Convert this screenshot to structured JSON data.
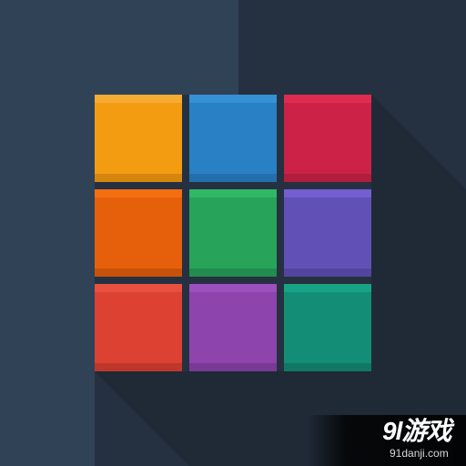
{
  "colors": {
    "background": "#253140",
    "background_light": "#304256",
    "long_shadow": "#1f2a36"
  },
  "tiles": [
    {
      "name": "tile-orange",
      "color": "#f39c12",
      "top": "#f6ab33",
      "bottom": "#d4860f"
    },
    {
      "name": "tile-blue",
      "color": "#2980c4",
      "top": "#3591d4",
      "bottom": "#236fac"
    },
    {
      "name": "tile-crimson",
      "color": "#cc2247",
      "top": "#de2c50",
      "bottom": "#b01d3d"
    },
    {
      "name": "tile-dark-orange",
      "color": "#e6600b",
      "top": "#f56f12",
      "bottom": "#c75209"
    },
    {
      "name": "tile-green",
      "color": "#27a45a",
      "top": "#2fb866",
      "bottom": "#218c4d"
    },
    {
      "name": "tile-indigo",
      "color": "#6151b7",
      "top": "#735fd1",
      "bottom": "#53459e"
    },
    {
      "name": "tile-red",
      "color": "#dc4132",
      "top": "#e8503f",
      "bottom": "#be372b"
    },
    {
      "name": "tile-purple",
      "color": "#8d44ad",
      "top": "#9b50bd",
      "bottom": "#793a95"
    },
    {
      "name": "tile-teal",
      "color": "#138d75",
      "top": "#17a386",
      "bottom": "#107864"
    }
  ],
  "watermark": {
    "logo_text": "9l游戏",
    "domain_text": "91danji.com"
  }
}
